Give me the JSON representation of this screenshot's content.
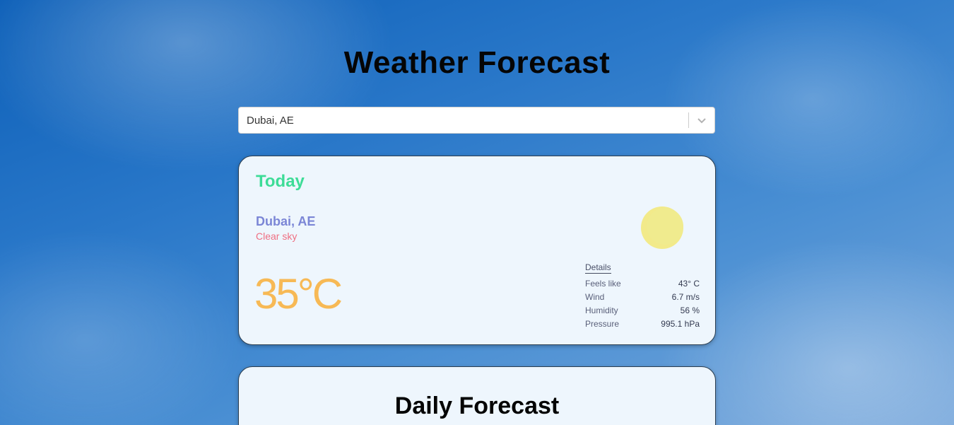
{
  "page": {
    "title": "Weather Forecast"
  },
  "search": {
    "selected": "Dubai, AE"
  },
  "today": {
    "label": "Today",
    "city": "Dubai, AE",
    "description": "Clear sky",
    "icon": "sun-icon",
    "temperature": "35°C",
    "details": {
      "title": "Details",
      "rows": [
        {
          "label": "Feels like",
          "value": "43° C"
        },
        {
          "label": "Wind",
          "value": "6.7 m/s"
        },
        {
          "label": "Humidity",
          "value": "56 %"
        },
        {
          "label": "Pressure",
          "value": "995.1 hPa"
        }
      ]
    }
  },
  "daily": {
    "title": "Daily Forecast"
  },
  "colors": {
    "today_label": "#3ddc97",
    "city": "#7b86d6",
    "description": "#ef6f82",
    "temperature": "#f7b955",
    "sun": "#f2ea8a"
  }
}
